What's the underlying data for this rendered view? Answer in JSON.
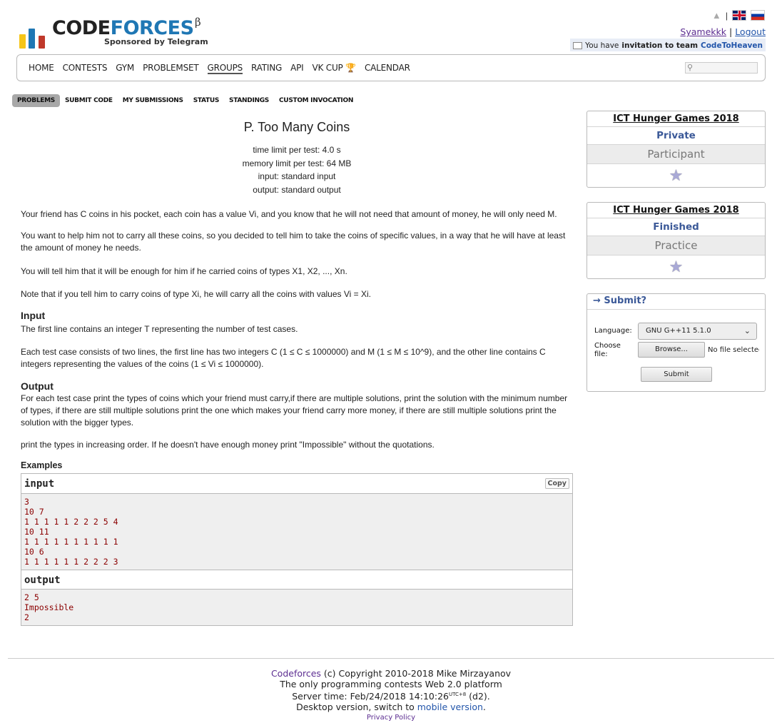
{
  "header": {
    "logo_text_code": "Code",
    "logo_text_forces": "forces",
    "logo_beta": "β",
    "sponsor": "Sponsored by Telegram",
    "lang_separator": "|",
    "user": "Syamekkk",
    "user_sep": "|",
    "logout": "Logout",
    "invite_prefix": "You have ",
    "invite_bold": "invitation to team",
    "invite_team": "CodeToHeaven"
  },
  "menu": {
    "items": [
      "Home",
      "Contests",
      "Gym",
      "Problemset",
      "Groups",
      "Rating",
      "API",
      "VK Cup",
      "Calendar"
    ],
    "current": "Groups"
  },
  "second_menu": {
    "items": [
      "Problems",
      "Submit Code",
      "My Submissions",
      "Status",
      "Standings",
      "Custom Invocation"
    ],
    "active": "Problems"
  },
  "problem": {
    "title": "P. Too Many Coins",
    "time_limit": "time limit per test: 4.0 s",
    "memory_limit": "memory limit per test: 64 MB",
    "input": "input: standard input",
    "output": "output: standard output",
    "legend_1": "Your friend has C coins in his pocket, each coin has a value Vi, and you know that he will not need that amount of money, he will only need M.",
    "legend_2": "You want to help him not to carry all these coins, so you decided to tell him to take the coins of specific values, in a way that he will have at least the amount of money he needs.",
    "legend_3": "You will tell him that it will be enough for him if he carried coins of types X1, X2, ..., Xn.",
    "legend_4": "Note that if you tell him to carry coins of type Xi, he will carry all the coins with values Vi = Xi.",
    "input_title": "Input",
    "input_1": "The first line contains an integer T representing the number of test cases.",
    "input_2": "Each test case consists of two lines, the first line has two integers C (1 ≤ C ≤ 1000000) and M (1 ≤ M ≤ 10^9), and the other line contains C integers representing the values of the coins (1 ≤ Vi ≤ 1000000).",
    "output_title": "Output",
    "output_1": "For each test case print the types of coins which your friend must carry,if there are multiple solutions, print the solution with the minimum number of types, if there are still multiple solutions print the one which makes your friend carry more money, if there are still multiple solutions print the solution with the bigger types.",
    "output_2": "print the types in increasing order. If he doesn't have enough money print \"Impossible\" without the quotations.",
    "examples_title": "Examples",
    "sample_input_label": "input",
    "sample_output_label": "output",
    "copy_label": "Copy",
    "sample_input": "3\n10 7\n1 1 1 1 1 2 2 2 5 4\n10 11\n1 1 1 1 1 1 1 1 1 1\n10 6\n1 1 1 1 1 1 2 2 2 3",
    "sample_output": "2 5\nImpossible\n2"
  },
  "sidebar": {
    "boxes": [
      {
        "title": "ICT Hunger Games 2018",
        "type": "Private",
        "role": "Participant"
      },
      {
        "title": "ICT Hunger Games 2018",
        "type": "Finished",
        "role": "Practice"
      }
    ],
    "submit": {
      "title": "→ Submit?",
      "language_label": "Language:",
      "language_value": "GNU G++11 5.1.0",
      "file_label": "Choose file:",
      "browse": "Browse...",
      "no_file": "No file selected.",
      "submit": "Submit"
    }
  },
  "footer": {
    "link": "Codeforces",
    "copyright": " (c) Copyright 2010-2018 Mike Mirzayanov",
    "line2": "The only programming contests Web 2.0 platform",
    "server_time": "Server time: Feb/24/2018 14:10:26",
    "utc": "UTC+8",
    "d2": " (d2).",
    "desktop": "Desktop version, switch to ",
    "mobile": "mobile version",
    "dot": ".",
    "privacy": "Privacy Policy"
  },
  "colors": {
    "accent": "#3b5998",
    "link_visited": "#5c2d91",
    "sample_text": "#8b0000"
  }
}
